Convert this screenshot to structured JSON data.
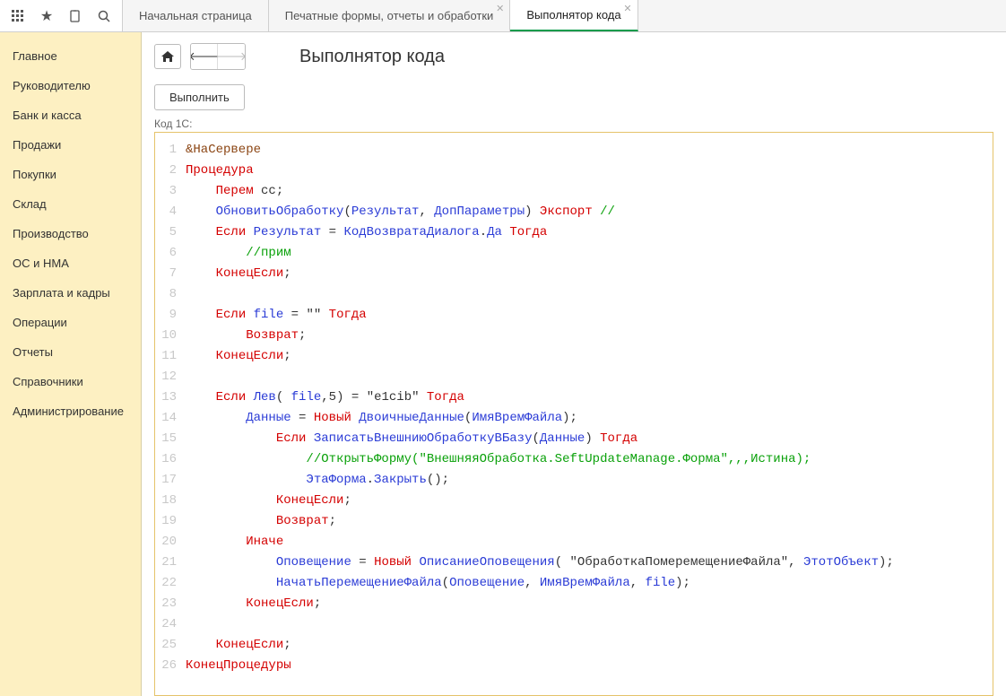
{
  "toolbar": {
    "icons": [
      "apps-icon",
      "star-icon",
      "clipboard-icon",
      "search-icon"
    ]
  },
  "tabs": [
    {
      "label": "Начальная страница",
      "closeable": false,
      "active": false
    },
    {
      "label": "Печатные формы, отчеты и обработки",
      "closeable": true,
      "active": false
    },
    {
      "label": "Выполнятор кода",
      "closeable": true,
      "active": true
    }
  ],
  "sidebar": [
    "Главное",
    "Руководителю",
    "Банк и касса",
    "Продажи",
    "Покупки",
    "Склад",
    "Производство",
    "ОС и НМА",
    "Зарплата и кадры",
    "Операции",
    "Отчеты",
    "Справочники",
    "Администрирование"
  ],
  "page": {
    "title": "Выполнятор кода",
    "run_label": "Выполнить",
    "code_label": "Код 1С:"
  },
  "code": [
    [
      {
        "c": "brown",
        "t": "&НаСервере"
      }
    ],
    [
      {
        "c": "kw",
        "t": "Процедура"
      }
    ],
    [
      {
        "c": "plain",
        "t": "    "
      },
      {
        "c": "kw",
        "t": "Перем"
      },
      {
        "c": "plain",
        "t": " сс;"
      }
    ],
    [
      {
        "c": "plain",
        "t": "    "
      },
      {
        "c": "id",
        "t": "ОбновитьОбработку"
      },
      {
        "c": "plain",
        "t": "("
      },
      {
        "c": "id",
        "t": "Результат"
      },
      {
        "c": "plain",
        "t": ", "
      },
      {
        "c": "id",
        "t": "ДопПараметры"
      },
      {
        "c": "plain",
        "t": ") "
      },
      {
        "c": "kw",
        "t": "Экспорт"
      },
      {
        "c": "plain",
        "t": " "
      },
      {
        "c": "com",
        "t": "//"
      }
    ],
    [
      {
        "c": "plain",
        "t": "    "
      },
      {
        "c": "kw",
        "t": "Если"
      },
      {
        "c": "plain",
        "t": " "
      },
      {
        "c": "id",
        "t": "Результат"
      },
      {
        "c": "plain",
        "t": " = "
      },
      {
        "c": "id",
        "t": "КодВозвратаДиалога"
      },
      {
        "c": "plain",
        "t": "."
      },
      {
        "c": "id",
        "t": "Да"
      },
      {
        "c": "plain",
        "t": " "
      },
      {
        "c": "kw",
        "t": "Тогда"
      }
    ],
    [
      {
        "c": "plain",
        "t": "        "
      },
      {
        "c": "com",
        "t": "//прим"
      }
    ],
    [
      {
        "c": "plain",
        "t": "    "
      },
      {
        "c": "kw",
        "t": "КонецЕсли"
      },
      {
        "c": "plain",
        "t": ";"
      }
    ],
    [],
    [
      {
        "c": "plain",
        "t": "    "
      },
      {
        "c": "kw",
        "t": "Если"
      },
      {
        "c": "plain",
        "t": " "
      },
      {
        "c": "id",
        "t": "file"
      },
      {
        "c": "plain",
        "t": " = "
      },
      {
        "c": "str",
        "t": "\"\""
      },
      {
        "c": "plain",
        "t": " "
      },
      {
        "c": "kw",
        "t": "Тогда"
      }
    ],
    [
      {
        "c": "plain",
        "t": "        "
      },
      {
        "c": "kw",
        "t": "Возврат"
      },
      {
        "c": "plain",
        "t": ";"
      }
    ],
    [
      {
        "c": "plain",
        "t": "    "
      },
      {
        "c": "kw",
        "t": "КонецЕсли"
      },
      {
        "c": "plain",
        "t": ";"
      }
    ],
    [],
    [
      {
        "c": "plain",
        "t": "    "
      },
      {
        "c": "kw",
        "t": "Если"
      },
      {
        "c": "plain",
        "t": " "
      },
      {
        "c": "id",
        "t": "Лев"
      },
      {
        "c": "plain",
        "t": "( "
      },
      {
        "c": "id",
        "t": "file"
      },
      {
        "c": "plain",
        "t": ",5) = "
      },
      {
        "c": "str",
        "t": "\"e1cib\""
      },
      {
        "c": "plain",
        "t": " "
      },
      {
        "c": "kw",
        "t": "Тогда"
      }
    ],
    [
      {
        "c": "plain",
        "t": "        "
      },
      {
        "c": "id",
        "t": "Данные"
      },
      {
        "c": "plain",
        "t": " = "
      },
      {
        "c": "kw",
        "t": "Новый"
      },
      {
        "c": "plain",
        "t": " "
      },
      {
        "c": "id",
        "t": "ДвоичныеДанные"
      },
      {
        "c": "plain",
        "t": "("
      },
      {
        "c": "id",
        "t": "ИмяВремФайла"
      },
      {
        "c": "plain",
        "t": ");"
      }
    ],
    [
      {
        "c": "plain",
        "t": "            "
      },
      {
        "c": "kw",
        "t": "Если"
      },
      {
        "c": "plain",
        "t": " "
      },
      {
        "c": "id",
        "t": "ЗаписатьВнешниюОбработкуВБазу"
      },
      {
        "c": "plain",
        "t": "("
      },
      {
        "c": "id",
        "t": "Данные"
      },
      {
        "c": "plain",
        "t": ") "
      },
      {
        "c": "kw",
        "t": "Тогда"
      }
    ],
    [
      {
        "c": "plain",
        "t": "                "
      },
      {
        "c": "com",
        "t": "//ОткрытьФорму(\"ВнешняяОбработка.SeftUpdateManage.Форма\",,,Истина);"
      }
    ],
    [
      {
        "c": "plain",
        "t": "                "
      },
      {
        "c": "id",
        "t": "ЭтаФорма"
      },
      {
        "c": "plain",
        "t": "."
      },
      {
        "c": "id",
        "t": "Закрыть"
      },
      {
        "c": "plain",
        "t": "();"
      }
    ],
    [
      {
        "c": "plain",
        "t": "            "
      },
      {
        "c": "kw",
        "t": "КонецЕсли"
      },
      {
        "c": "plain",
        "t": ";"
      }
    ],
    [
      {
        "c": "plain",
        "t": "            "
      },
      {
        "c": "kw",
        "t": "Возврат"
      },
      {
        "c": "plain",
        "t": ";"
      }
    ],
    [
      {
        "c": "plain",
        "t": "        "
      },
      {
        "c": "kw",
        "t": "Иначе"
      }
    ],
    [
      {
        "c": "plain",
        "t": "            "
      },
      {
        "c": "id",
        "t": "Оповещение"
      },
      {
        "c": "plain",
        "t": " = "
      },
      {
        "c": "kw",
        "t": "Новый"
      },
      {
        "c": "plain",
        "t": " "
      },
      {
        "c": "id",
        "t": "ОписаниеОповещения"
      },
      {
        "c": "plain",
        "t": "( "
      },
      {
        "c": "str",
        "t": "\"ОбработкаПомеремещениеФайла\""
      },
      {
        "c": "plain",
        "t": ", "
      },
      {
        "c": "id",
        "t": "ЭтотОбъект"
      },
      {
        "c": "plain",
        "t": ");"
      }
    ],
    [
      {
        "c": "plain",
        "t": "            "
      },
      {
        "c": "id",
        "t": "НачатьПеремещениеФайла"
      },
      {
        "c": "plain",
        "t": "("
      },
      {
        "c": "id",
        "t": "Оповещение"
      },
      {
        "c": "plain",
        "t": ", "
      },
      {
        "c": "id",
        "t": "ИмяВремФайла"
      },
      {
        "c": "plain",
        "t": ", "
      },
      {
        "c": "id",
        "t": "file"
      },
      {
        "c": "plain",
        "t": ");"
      }
    ],
    [
      {
        "c": "plain",
        "t": "        "
      },
      {
        "c": "kw",
        "t": "КонецЕсли"
      },
      {
        "c": "plain",
        "t": ";"
      }
    ],
    [],
    [
      {
        "c": "plain",
        "t": "    "
      },
      {
        "c": "kw",
        "t": "КонецЕсли"
      },
      {
        "c": "plain",
        "t": ";"
      }
    ],
    [
      {
        "c": "kw",
        "t": "КонецПроцедуры"
      }
    ]
  ]
}
